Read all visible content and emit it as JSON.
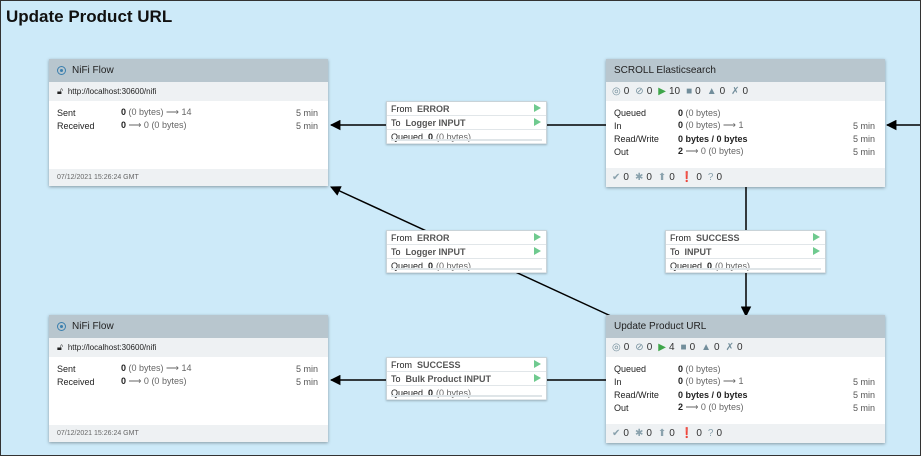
{
  "canvas_title": "Update Product URL",
  "remote_groups": [
    {
      "name": "NiFi Flow",
      "url": "http://localhost:30600/nifi",
      "sent_label": "Sent",
      "sent_count": "0",
      "sent_rest": "(0 bytes) ⟶ 14",
      "sent_window": "5 min",
      "recv_label": "Received",
      "recv_count": "0",
      "recv_rest": "⟶ 0 (0 bytes)",
      "recv_window": "5 min",
      "timestamp": "07/12/2021 15:26:24 GMT"
    },
    {
      "name": "NiFi Flow",
      "url": "http://localhost:30600/nifi",
      "sent_label": "Sent",
      "sent_count": "0",
      "sent_rest": "(0 bytes) ⟶ 14",
      "sent_window": "5 min",
      "recv_label": "Received",
      "recv_count": "0",
      "recv_rest": "⟶ 0 (0 bytes)",
      "recv_window": "5 min",
      "timestamp": "07/12/2021 15:26:24 GMT"
    }
  ],
  "process_groups": [
    {
      "name": "SCROLL Elasticsearch",
      "counts": {
        "transmitting": "0",
        "not_transmitting": "0",
        "running": "10",
        "stopped": "0",
        "invalid": "0",
        "disabled": "0"
      },
      "queued_label": "Queued",
      "queued_count": "0",
      "queued_rest": "(0 bytes)",
      "in_label": "In",
      "in_count": "0",
      "in_rest": "(0 bytes) ⟶ 1",
      "in_window": "5 min",
      "rw_label": "Read/Write",
      "rw_value": "0 bytes / 0 bytes",
      "rw_window": "5 min",
      "out_label": "Out",
      "out_count": "2",
      "out_rest": "⟶ 0 (0 bytes)",
      "out_window": "5 min",
      "versions": {
        "up_to_date": "0",
        "locally_modified": "0",
        "stale": "0",
        "modified_stale": "0",
        "sync_failure": "0"
      }
    },
    {
      "name": "Update Product URL",
      "counts": {
        "transmitting": "0",
        "not_transmitting": "0",
        "running": "4",
        "stopped": "0",
        "invalid": "0",
        "disabled": "0"
      },
      "queued_label": "Queued",
      "queued_count": "0",
      "queued_rest": "(0 bytes)",
      "in_label": "In",
      "in_count": "0",
      "in_rest": "(0 bytes) ⟶ 1",
      "in_window": "5 min",
      "rw_label": "Read/Write",
      "rw_value": "0 bytes / 0 bytes",
      "rw_window": "5 min",
      "out_label": "Out",
      "out_count": "2",
      "out_rest": "⟶ 0 (0 bytes)",
      "out_window": "5 min",
      "versions": {
        "up_to_date": "0",
        "locally_modified": "0",
        "stale": "0",
        "modified_stale": "0",
        "sync_failure": "0"
      }
    }
  ],
  "connections": [
    {
      "from_key": "From",
      "from": "ERROR",
      "to_key": "To",
      "to": "Logger INPUT",
      "queued_key": "Queued",
      "queued": "0",
      "queued_rest": "(0 bytes)"
    },
    {
      "from_key": "From",
      "from": "ERROR",
      "to_key": "To",
      "to": "Logger INPUT",
      "queued_key": "Queued",
      "queued": "0",
      "queued_rest": "(0 bytes)"
    },
    {
      "from_key": "From",
      "from": "SUCCESS",
      "to_key": "To",
      "to": "INPUT",
      "queued_key": "Queued",
      "queued": "0",
      "queued_rest": "(0 bytes)"
    },
    {
      "from_key": "From",
      "from": "SUCCESS",
      "to_key": "To",
      "to": "Bulk Product INPUT",
      "queued_key": "Queued",
      "queued": "0",
      "queued_rest": "(0 bytes)"
    }
  ],
  "icons": {
    "remote_group": "remote-process-group-icon",
    "lock": "unlocked-icon",
    "transmitting": "transmitting-icon",
    "not_transmitting": "not-transmitting-icon",
    "running": "play-icon",
    "stopped": "stop-icon",
    "invalid": "warning-icon",
    "disabled": "disabled-icon",
    "up_to_date": "check-icon",
    "locally_modified": "asterisk-icon",
    "stale": "arrow-up-icon",
    "modified_stale": "exclamation-icon",
    "sync_failure": "question-icon"
  },
  "colors": {
    "canvas": "#cdeaf9",
    "header": "#b8c6ce",
    "running": "#3fa64a",
    "relationship_arrow": "#6fca8f"
  }
}
